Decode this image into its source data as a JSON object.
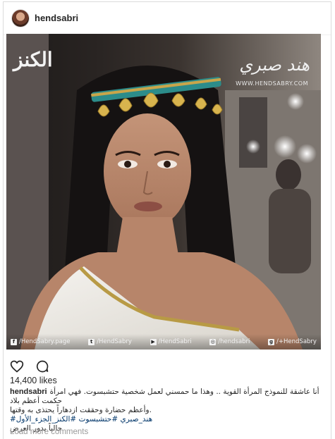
{
  "post": {
    "username": "hendsabri",
    "likes": "14,400 likes",
    "caption_user": "hendsabri",
    "caption_lines": [
      "أنا عاشقة للنموذج المرأة القوية .. وهذا ما حمسني لعمل شخصية حتشبسوت. فهي امرأة حكمت أعظم بلاد",
      ".وأعظم حضارة وحققت ازدهاراً يحتذى به وقتها",
      "هند_صبري #حتشبسوت #الكنز_الجزء_الأول#",
      "حالياً بدور العرض"
    ],
    "load_more": "Load more comments"
  },
  "photo": {
    "watermark_left": "الكنز",
    "watermark_right": "هند صبري",
    "watermark_site": "WWW.HENDSABRY.COM",
    "social": [
      {
        "icon": "facebook-icon",
        "glyph": "f",
        "label": "/HendSabry.page"
      },
      {
        "icon": "twitter-icon",
        "glyph": "t",
        "label": "/HendSabry"
      },
      {
        "icon": "youtube-icon",
        "glyph": "▶",
        "label": "/HendSabri"
      },
      {
        "icon": "instagram-icon",
        "glyph": "◎",
        "label": "/hendsabri"
      },
      {
        "icon": "googleplus-icon",
        "glyph": "g",
        "label": "/+HendSabry"
      }
    ]
  },
  "colors": {
    "text": "#262626",
    "muted": "#999999",
    "border": "#dbdbdb",
    "hashtag": "#003569"
  }
}
